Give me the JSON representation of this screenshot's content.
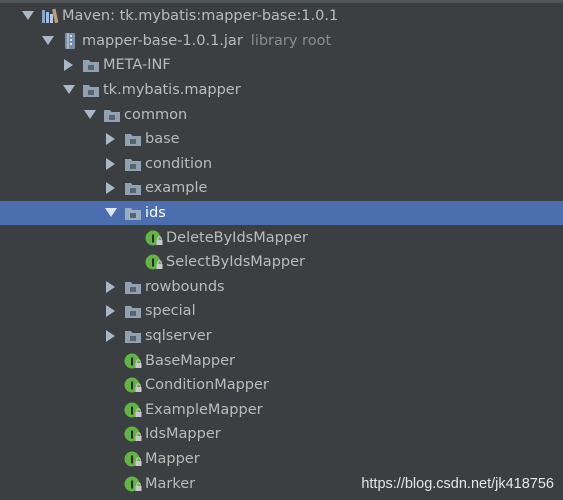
{
  "tree": {
    "rows": [
      {
        "label": "Maven: tk.mybatis:mapper-base:1.0.1",
        "secondary": "",
        "icon": "maven-library-icon",
        "expanded": true
      },
      {
        "label": "mapper-base-1.0.1.jar",
        "secondary": "library root",
        "icon": "jar-icon",
        "expanded": true
      },
      {
        "label": "META-INF",
        "secondary": "",
        "icon": "package-folder-icon",
        "expanded": false
      },
      {
        "label": "tk.mybatis.mapper",
        "secondary": "",
        "icon": "package-folder-icon",
        "expanded": true
      },
      {
        "label": "common",
        "secondary": "",
        "icon": "package-folder-icon",
        "expanded": true
      },
      {
        "label": "base",
        "secondary": "",
        "icon": "package-folder-icon",
        "expanded": false
      },
      {
        "label": "condition",
        "secondary": "",
        "icon": "package-folder-icon",
        "expanded": false
      },
      {
        "label": "example",
        "secondary": "",
        "icon": "package-folder-icon",
        "expanded": false
      },
      {
        "label": "ids",
        "secondary": "",
        "icon": "package-folder-icon",
        "expanded": true,
        "selected": true
      },
      {
        "label": "DeleteByIdsMapper",
        "secondary": "",
        "icon": "interface-locked-icon"
      },
      {
        "label": "SelectByIdsMapper",
        "secondary": "",
        "icon": "interface-locked-icon"
      },
      {
        "label": "rowbounds",
        "secondary": "",
        "icon": "package-folder-icon",
        "expanded": false
      },
      {
        "label": "special",
        "secondary": "",
        "icon": "package-folder-icon",
        "expanded": false
      },
      {
        "label": "sqlserver",
        "secondary": "",
        "icon": "package-folder-icon",
        "expanded": false
      },
      {
        "label": "BaseMapper",
        "secondary": "",
        "icon": "interface-locked-icon"
      },
      {
        "label": "ConditionMapper",
        "secondary": "",
        "icon": "interface-locked-icon"
      },
      {
        "label": "ExampleMapper",
        "secondary": "",
        "icon": "interface-locked-icon"
      },
      {
        "label": "IdsMapper",
        "secondary": "",
        "icon": "interface-locked-icon"
      },
      {
        "label": "Mapper",
        "secondary": "",
        "icon": "interface-locked-icon"
      },
      {
        "label": "Marker",
        "secondary": "",
        "icon": "interface-locked-icon"
      }
    ]
  },
  "watermark": "https://blog.csdn.net/jk418756",
  "colors": {
    "background": "#3c3f41",
    "selection": "#4b6eaf",
    "text": "#bbbbbb",
    "interface_icon": "#62b543"
  }
}
